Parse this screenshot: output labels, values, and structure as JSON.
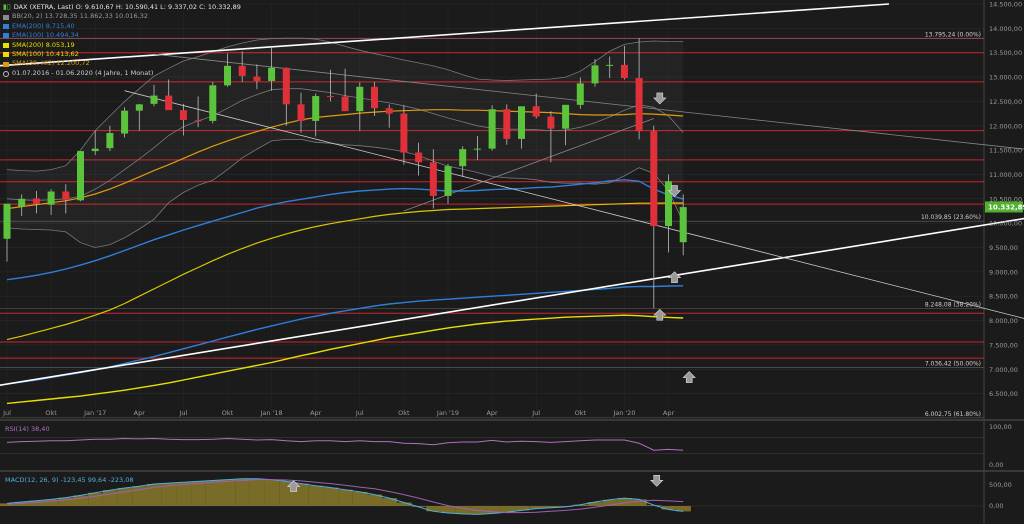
{
  "header": {
    "symbol_line": "DAX (XETRA, Last)  O: 9.610,67  H: 10.590,41  L: 9.337,02  C: 10.332,89",
    "range": "01.07.2016 - 01.06.2020   (4 Jahre, 1 Monat)"
  },
  "legend": [
    {
      "text": "BB(20, 2)  13.728,35  11.862,33  10.016,32",
      "color": "#8a8a8a"
    },
    {
      "text": "EMA(200)  8.715,40",
      "color": "#2f7fd8"
    },
    {
      "text": "EMA(100)  10.494,34",
      "color": "#2f7fd8"
    },
    {
      "text": "SMA(200)  8.053,19",
      "color": "#e8e000"
    },
    {
      "text": "SMA(100)  10.413,62",
      "color": "#e8e000"
    },
    {
      "text": "SMA(38, Hi2)  12.200,72",
      "color": "#e09a10"
    }
  ],
  "colors": {
    "up": "#5cc43c",
    "down": "#e0303a",
    "bg": "#1b1b1b"
  },
  "current_price_label": "10.332,89",
  "fib_labels": [
    {
      "text": "13.795,24 (0.00%)",
      "value": 13795.24
    },
    {
      "text": "10.039,85 (23.60%)",
      "value": 10039.85
    },
    {
      "text": "8.248,08 (38.20%)",
      "value": 8248.08
    },
    {
      "text": "7.036,42 (50.00%)",
      "value": 7036.42
    },
    {
      "text": "6.002,75 (61.80%)",
      "value": 6002.75
    }
  ],
  "indicators": {
    "rsi_label": "RSI(14)  38,40",
    "macd_label": "MACD(12, 26, 9)  -123,45  99,64  -223,08",
    "rsi_ticks": [
      "100,00",
      "0,00"
    ],
    "macd_ticks": [
      "500,00",
      "0,00"
    ]
  },
  "chart_data": {
    "type": "candlestick",
    "interval": "monthly",
    "y_axis": {
      "min": 6000,
      "max": 14500,
      "ticks": [
        6500,
        7000,
        7500,
        8000,
        8500,
        9000,
        9500,
        10000,
        10500,
        11000,
        11500,
        12000,
        12500,
        13000,
        13500,
        14000,
        14500
      ],
      "tick_labels": [
        "6.500,00",
        "7.000,00",
        "7.500,00",
        "8.000,00",
        "8.500,00",
        "9.000,00",
        "9.500,00",
        "10.000,00",
        "10.500,00",
        "11.000,00",
        "11.500,00",
        "12.000,00",
        "12.500,00",
        "13.000,00",
        "13.500,00",
        "14.000,00",
        "14.500,00"
      ]
    },
    "x_labels": [
      "Jul",
      "Okt",
      "Jan '17",
      "Apr",
      "Jul",
      "Okt",
      "Jan '18",
      "Apr",
      "Jul",
      "Okt",
      "Jan '19",
      "Apr",
      "Jul",
      "Okt",
      "Jan '20",
      "Apr"
    ],
    "x_label_month_index": [
      0,
      3,
      6,
      9,
      12,
      15,
      18,
      21,
      24,
      27,
      30,
      33,
      36,
      39,
      42,
      45
    ],
    "candles": [
      [
        9680,
        10340,
        9210,
        10400
      ],
      [
        10340,
        10590,
        10150,
        10500
      ],
      [
        10510,
        10660,
        10200,
        10400
      ],
      [
        10380,
        10700,
        10170,
        10650
      ],
      [
        10650,
        10800,
        10200,
        10480
      ],
      [
        10470,
        11480,
        10450,
        11480
      ],
      [
        11480,
        11900,
        11400,
        11530
      ],
      [
        11540,
        12000,
        11480,
        11850
      ],
      [
        11840,
        12380,
        11760,
        12310
      ],
      [
        12310,
        12450,
        11900,
        12440
      ],
      [
        12450,
        12840,
        12400,
        12620
      ],
      [
        12620,
        12950,
        12460,
        12320
      ],
      [
        12320,
        12450,
        11800,
        12120
      ],
      [
        12110,
        12600,
        11970,
        12100
      ],
      [
        12100,
        12900,
        12050,
        12830
      ],
      [
        12830,
        13480,
        12800,
        13230
      ],
      [
        13230,
        13530,
        12900,
        13020
      ],
      [
        13010,
        13260,
        12750,
        12920
      ],
      [
        12920,
        13600,
        12720,
        13190
      ],
      [
        13190,
        13200,
        12000,
        12440
      ],
      [
        12440,
        12680,
        11860,
        12100
      ],
      [
        12100,
        12660,
        11780,
        12610
      ],
      [
        12610,
        13150,
        12500,
        12600
      ],
      [
        12600,
        13170,
        12300,
        12300
      ],
      [
        12300,
        12890,
        11900,
        12800
      ],
      [
        12800,
        12900,
        12200,
        12360
      ],
      [
        12360,
        12440,
        11960,
        12250
      ],
      [
        12250,
        12420,
        11200,
        11450
      ],
      [
        11450,
        11650,
        10980,
        11250
      ],
      [
        11250,
        11520,
        10300,
        10560
      ],
      [
        10560,
        11220,
        10400,
        11170
      ],
      [
        11170,
        11580,
        10950,
        11520
      ],
      [
        11520,
        11790,
        11300,
        11530
      ],
      [
        11530,
        12420,
        11490,
        12340
      ],
      [
        12340,
        12440,
        11610,
        11730
      ],
      [
        11730,
        12340,
        11530,
        12400
      ],
      [
        12400,
        12660,
        12150,
        12190
      ],
      [
        12190,
        12300,
        11250,
        11940
      ],
      [
        11940,
        12400,
        11600,
        12430
      ],
      [
        12430,
        12990,
        12350,
        12870
      ],
      [
        12870,
        13370,
        12800,
        13240
      ],
      [
        13240,
        13420,
        12980,
        13250
      ],
      [
        13250,
        13640,
        12950,
        12980
      ],
      [
        12980,
        13800,
        11720,
        11890
      ],
      [
        11890,
        12000,
        8250,
        9940
      ],
      [
        9940,
        11000,
        9400,
        10860
      ],
      [
        9610,
        10590,
        9340,
        10330
      ]
    ],
    "horizontal_levels": [
      13795.24,
      13500,
      12900,
      11900,
      11300,
      10850,
      10390,
      8150,
      7560,
      7230
    ],
    "bb_mid": [
      10500,
      10480,
      10470,
      10480,
      10500,
      10550,
      10700,
      10880,
      11100,
      11320,
      11550,
      11800,
      11980,
      12100,
      12200,
      12360,
      12520,
      12640,
      12740,
      12760,
      12760,
      12720,
      12680,
      12620,
      12570,
      12520,
      12470,
      12410,
      12340,
      12250,
      12160,
      12080,
      12000,
      11950,
      11930,
      11930,
      11920,
      11900,
      11910,
      11970,
      12060,
      12180,
      12320,
      12430,
      12380,
      12200,
      11862
    ],
    "bb_upper": [
      11100,
      11080,
      11070,
      11100,
      11180,
      11500,
      11900,
      12200,
      12500,
      12760,
      13020,
      13180,
      13330,
      13420,
      13520,
      13620,
      13700,
      13760,
      13790,
      13800,
      13800,
      13780,
      13720,
      13630,
      13550,
      13480,
      13420,
      13350,
      13290,
      13230,
      13150,
      13050,
      12960,
      12940,
      12930,
      12940,
      12950,
      12960,
      13000,
      13120,
      13320,
      13530,
      13670,
      13720,
      13740,
      13730,
      13728
    ],
    "bb_lower": [
      9900,
      9880,
      9870,
      9860,
      9820,
      9600,
      9500,
      9560,
      9700,
      9880,
      10080,
      10420,
      10630,
      10780,
      10880,
      11100,
      11340,
      11520,
      11690,
      11720,
      11720,
      11660,
      11640,
      11610,
      11590,
      11560,
      11520,
      11470,
      11390,
      11270,
      11170,
      11110,
      11040,
      10960,
      10930,
      10920,
      10890,
      10840,
      10820,
      10820,
      10800,
      10830,
      10970,
      11140,
      11020,
      10670,
      10016
    ],
    "sma38_hi": [
      10300,
      10340,
      10380,
      10420,
      10460,
      10520,
      10600,
      10700,
      10820,
      10950,
      11080,
      11200,
      11330,
      11460,
      11580,
      11690,
      11790,
      11880,
      11970,
      12050,
      12120,
      12170,
      12200,
      12230,
      12260,
      12280,
      12300,
      12310,
      12320,
      12330,
      12330,
      12320,
      12320,
      12310,
      12300,
      12290,
      12280,
      12270,
      12250,
      12230,
      12220,
      12220,
      12230,
      12250,
      12240,
      12220,
      12200
    ],
    "sma100": [
      7610,
      7680,
      7760,
      7840,
      7920,
      8010,
      8110,
      8220,
      8350,
      8500,
      8650,
      8800,
      8950,
      9090,
      9230,
      9360,
      9480,
      9590,
      9690,
      9780,
      9860,
      9930,
      9990,
      10040,
      10090,
      10140,
      10180,
      10210,
      10240,
      10260,
      10280,
      10290,
      10300,
      10310,
      10320,
      10330,
      10340,
      10350,
      10360,
      10370,
      10380,
      10390,
      10400,
      10410,
      10410,
      10415,
      10414
    ],
    "ema100": [
      8840,
      8880,
      8930,
      8990,
      9060,
      9140,
      9230,
      9330,
      9440,
      9550,
      9660,
      9760,
      9860,
      9950,
      10040,
      10130,
      10220,
      10310,
      10380,
      10440,
      10490,
      10540,
      10590,
      10630,
      10660,
      10680,
      10700,
      10710,
      10700,
      10680,
      10660,
      10660,
      10670,
      10690,
      10700,
      10710,
      10730,
      10740,
      10770,
      10800,
      10830,
      10870,
      10890,
      10860,
      10700,
      10580,
      10494
    ],
    "ema200": [
      6700,
      6740,
      6780,
      6830,
      6880,
      6930,
      6990,
      7050,
      7120,
      7190,
      7260,
      7340,
      7420,
      7500,
      7580,
      7660,
      7740,
      7820,
      7890,
      7960,
      8030,
      8090,
      8150,
      8200,
      8250,
      8300,
      8340,
      8370,
      8400,
      8420,
      8440,
      8460,
      8480,
      8500,
      8520,
      8540,
      8560,
      8580,
      8600,
      8620,
      8640,
      8660,
      8690,
      8700,
      8700,
      8710,
      8715
    ],
    "sma200": [
      6300,
      6330,
      6360,
      6390,
      6420,
      6450,
      6490,
      6530,
      6570,
      6620,
      6670,
      6720,
      6780,
      6840,
      6900,
      6960,
      7020,
      7080,
      7140,
      7210,
      7280,
      7340,
      7410,
      7470,
      7530,
      7590,
      7650,
      7700,
      7750,
      7800,
      7850,
      7890,
      7930,
      7960,
      7990,
      8010,
      8030,
      8050,
      8070,
      8080,
      8090,
      8100,
      8110,
      8100,
      8080,
      8065,
      8053
    ],
    "trendlines": [
      {
        "name": "upper-channel",
        "from": [
          -3,
          13180
        ],
        "to": [
          60,
          14500
        ],
        "color": "#ffffff"
      },
      {
        "name": "rising-support",
        "from": [
          -3,
          6550
        ],
        "to": [
          75,
          10380
        ],
        "color": "#ffffff"
      },
      {
        "name": "falling-line",
        "from": [
          8,
          12720
        ],
        "to": [
          75,
          7600
        ],
        "color": "#cccccc"
      },
      {
        "name": "falling-resistance",
        "from": [
          10,
          13470
        ],
        "to": [
          75,
          11330
        ],
        "color": "#888888"
      },
      {
        "name": "inner-rise",
        "from": [
          27,
          10250
        ],
        "to": [
          44,
          12150
        ],
        "color": "#888888"
      }
    ],
    "arrows": [
      {
        "month": 44,
        "value": 12550,
        "dir": "down"
      },
      {
        "month": 45,
        "value": 10650,
        "dir": "down"
      },
      {
        "month": 45,
        "value": 8900,
        "dir": "up"
      },
      {
        "month": 44,
        "value": 8130,
        "dir": "up"
      },
      {
        "month": 46,
        "value": 6850,
        "dir": "up"
      }
    ],
    "rsi": [
      58,
      60,
      61,
      62,
      62,
      64,
      66,
      66,
      68,
      67,
      68,
      66,
      65,
      65,
      66,
      68,
      66,
      64,
      65,
      62,
      60,
      62,
      62,
      60,
      62,
      60,
      60,
      56,
      55,
      52,
      57,
      59,
      59,
      63,
      59,
      61,
      60,
      58,
      60,
      62,
      64,
      64,
      64,
      56,
      38,
      40,
      38
    ],
    "macd": [
      60,
      90,
      120,
      150,
      190,
      240,
      300,
      360,
      410,
      450,
      500,
      520,
      540,
      560,
      580,
      600,
      620,
      620,
      600,
      560,
      510,
      460,
      420,
      370,
      320,
      260,
      180,
      80,
      -20,
      -120,
      -160,
      -180,
      -190,
      -170,
      -140,
      -100,
      -60,
      -40,
      -20,
      30,
      90,
      140,
      180,
      150,
      20,
      -80,
      -123
    ],
    "macd_signal": [
      40,
      60,
      80,
      110,
      140,
      180,
      220,
      270,
      320,
      370,
      420,
      460,
      490,
      510,
      540,
      560,
      580,
      600,
      600,
      590,
      570,
      540,
      510,
      470,
      430,
      390,
      330,
      260,
      180,
      90,
      10,
      -50,
      -100,
      -130,
      -150,
      -150,
      -140,
      -120,
      -100,
      -70,
      -30,
      20,
      70,
      110,
      130,
      115,
      100
    ]
  }
}
